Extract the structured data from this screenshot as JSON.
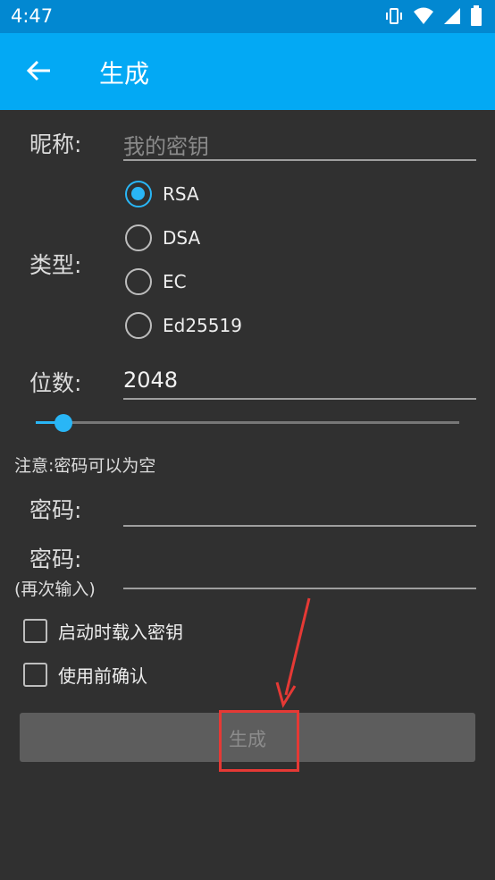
{
  "status_bar": {
    "time": "4:47",
    "icons": [
      "vibrate-icon",
      "wifi-icon",
      "signal-icon",
      "battery-icon"
    ]
  },
  "app_bar": {
    "title": "生成",
    "back_icon": "arrow-back-icon"
  },
  "form": {
    "nickname_label": "昵称:",
    "nickname_placeholder": "我的密钥",
    "type_label": "类型:",
    "types": [
      {
        "label": "RSA",
        "selected": true
      },
      {
        "label": "DSA",
        "selected": false
      },
      {
        "label": "EC",
        "selected": false
      },
      {
        "label": "Ed25519",
        "selected": false
      }
    ],
    "bits_label": "位数:",
    "bits_value": "2048",
    "bits_slider_fraction": 0.065,
    "note": "注意:密码可以为空",
    "password_label": "密码:",
    "password_confirm_label": "密码:",
    "password_confirm_sublabel": "(再次输入)",
    "load_on_start_label": "启动时载入密钥",
    "confirm_before_use_label": "使用前确认",
    "generate_button": "生成"
  },
  "colors": {
    "app_bar": "#03a9f4",
    "status_bar": "#0288d1",
    "background": "#303030",
    "accent": "#29b6f6",
    "annotation": "#e53935"
  }
}
